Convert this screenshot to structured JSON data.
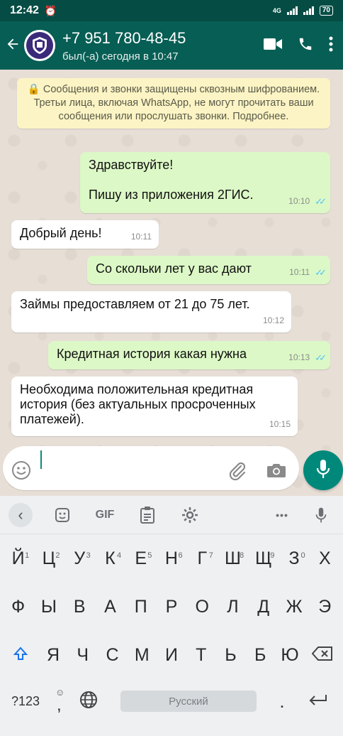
{
  "status_bar": {
    "time": "12:42",
    "network": "4G",
    "battery": "70"
  },
  "header": {
    "contact_name": "+7 951 780-48-45",
    "last_seen": "был(-а) сегодня в 10:47"
  },
  "notice": "🔒 Сообщения и звонки защищены сквозным шифрованием. Третьи лица, включая WhatsApp, не могут прочитать ваши сообщения или прослушать звонки. Подробнее.",
  "messages": [
    {
      "dir": "out",
      "text": "Здравствуйте!\n\nПишу из приложения 2ГИС.",
      "time": "10:10",
      "read": true
    },
    {
      "dir": "in",
      "text": "Добрый день!",
      "time": "10:11"
    },
    {
      "dir": "out",
      "text": "Со скольки лет у вас дают",
      "time": "10:11",
      "read": true
    },
    {
      "dir": "in",
      "text": "Займы предоставляем от 21 до 75 лет.",
      "time": "10:12"
    },
    {
      "dir": "out",
      "text": "Кредитная история какая нужна",
      "time": "10:13",
      "read": true
    },
    {
      "dir": "in",
      "text": "Необходима положительная кредитная история (без актуальных просроченных платежей).",
      "time": "10:15"
    }
  ],
  "input": {
    "value": ""
  },
  "keyboard": {
    "toolbar": {
      "gif": "GIF",
      "more": "•••"
    },
    "row1": [
      {
        "k": "Й",
        "n": "1"
      },
      {
        "k": "Ц",
        "n": "2"
      },
      {
        "k": "У",
        "n": "3"
      },
      {
        "k": "К",
        "n": "4"
      },
      {
        "k": "Е",
        "n": "5"
      },
      {
        "k": "Н",
        "n": "6"
      },
      {
        "k": "Г",
        "n": "7"
      },
      {
        "k": "Ш",
        "n": "8"
      },
      {
        "k": "Щ",
        "n": "9"
      },
      {
        "k": "З",
        "n": "0"
      },
      {
        "k": "Х",
        "n": ""
      }
    ],
    "row2": [
      "Ф",
      "Ы",
      "В",
      "А",
      "П",
      "Р",
      "О",
      "Л",
      "Д",
      "Ж",
      "Э"
    ],
    "row3": [
      "Я",
      "Ч",
      "С",
      "М",
      "И",
      "Т",
      "Ь",
      "Б",
      "Ю"
    ],
    "row4": {
      "symbols": "?123",
      "emoji_hint": "☺",
      "comma": ",",
      "space": "Русский",
      "period": "."
    }
  }
}
